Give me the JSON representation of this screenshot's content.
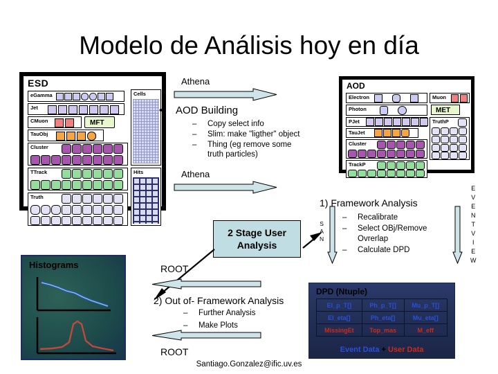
{
  "slide": {
    "title": "Modelo de Análisis hoy en día",
    "footer": "Santiago.Gonzalez@ific.uv.es"
  },
  "esd": {
    "title": "ESD",
    "rows": [
      {
        "label": "eGamma",
        "count": 6,
        "color": "c-blue"
      },
      {
        "label": "Jet",
        "count": 6,
        "color": "c-lav"
      },
      {
        "label": "CMuon",
        "count": 2,
        "color": "c-red"
      },
      {
        "label": "MFT",
        "count": 0,
        "color": "c-mft"
      },
      {
        "label": "TauObj",
        "count": 4,
        "color": "c-org"
      },
      {
        "label": "Cluster",
        "count": 6,
        "color": "c-pur"
      },
      {
        "label": "TTrack",
        "count": 6,
        "color": "c-grn"
      },
      {
        "label": "Truth",
        "count": 5,
        "color": "c-white"
      }
    ],
    "panels": [
      {
        "label": "Cells",
        "fill": "grid"
      },
      {
        "label": "Hits",
        "fill": "hits"
      }
    ]
  },
  "aod": {
    "title": "AOD",
    "rows": [
      {
        "label": "Electron",
        "count": 3,
        "color": "c-blue"
      },
      {
        "label": "Photon",
        "count": 2,
        "color": "c-blue"
      },
      {
        "label": "PJet",
        "count": 6,
        "color": "c-lav"
      },
      {
        "label": "TauJet",
        "count": 4,
        "color": "c-org"
      },
      {
        "label": "Cluster",
        "count": 5,
        "color": "c-pur"
      },
      {
        "label": "TrackP",
        "count": 6,
        "color": "c-grn"
      }
    ],
    "side": [
      {
        "label": "Muon",
        "count": 2,
        "color": "c-red"
      },
      {
        "label": "MET",
        "count": 0,
        "color": "c-mft"
      },
      {
        "label": "TruthP",
        "count": 0,
        "color": "c-white"
      }
    ]
  },
  "middle": {
    "athena_top": "Athena",
    "athena_bottom": "Athena",
    "aod_building": "AOD Building",
    "aod_building_sub": [
      "Copy select info",
      "Slim: make \"ligther\" object",
      "Thing (eg remove some",
      "truth particles)"
    ],
    "stage_box_line1": "2 Stage User",
    "stage_box_line2": "Analysis",
    "root_top": "ROOT",
    "root_bottom": "ROOT",
    "out_of_framework": "2) Out of- Framework Analysis",
    "out_of_framework_sub": [
      "Further Analysis",
      "Make Plots"
    ]
  },
  "right": {
    "framework_analysis": "1) Framework Analysis",
    "framework_sub": [
      "Recalibrate",
      "Select OBj/Remove",
      "Ovrerlap",
      "Calculate DPD"
    ],
    "san_letters": "S\nA\nN",
    "eventview_letters": "E\nV\nE\nN\nT\nV\nI\nE\nW"
  },
  "histograms": {
    "title": "Histograms"
  },
  "dpd": {
    "title": "DPD (Ntuple)",
    "rows": [
      {
        "cells": [
          "El_p_T[]",
          "Ph_p_T[]",
          "Mu_p_T[]"
        ],
        "kind": "event"
      },
      {
        "cells": [
          "El_eta[]",
          "Ph_eta[]",
          "Mu_eta[]"
        ],
        "kind": "event"
      },
      {
        "cells": [
          "MissingEt",
          "Top_mas",
          "M_eff"
        ],
        "kind": "user"
      }
    ],
    "legend_event": "Event Data",
    "legend_plus": "+",
    "legend_user": "User Data"
  },
  "colors": {
    "arrow_fill": "#cfe4e8",
    "stage_box_bg": "#bfdde2",
    "event_data": "#2a4fd6",
    "user_data": "#cc2b18",
    "dpd_bg": "#233059",
    "hist_bg": "#1d4a4a"
  }
}
